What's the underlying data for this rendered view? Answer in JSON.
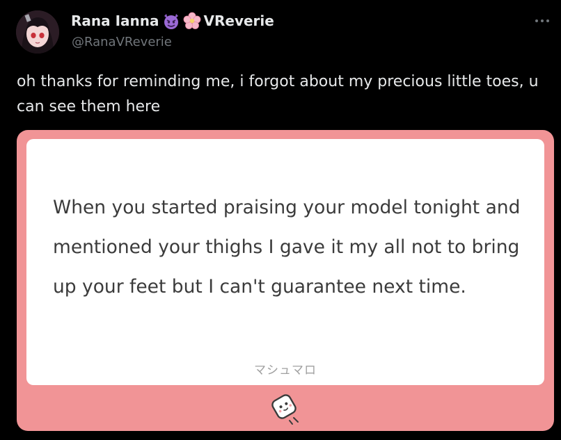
{
  "author": {
    "display_name": "Rana Ianna",
    "name_suffix": "VReverie",
    "handle": "@RanaVReverie",
    "emojis": [
      "smiling-imp-emoji",
      "cherry-blossom-emoji"
    ]
  },
  "tweet": {
    "text": "oh thanks for reminding me, i forgot about my precious little toes, u can see them here"
  },
  "card": {
    "question": "When you started praising your model tonight and mentioned your thighs I gave it my all not to bring up your feet but I can't guarantee next time.",
    "brand": "マシュマロ",
    "icon": "marshmallow-icon"
  },
  "colors": {
    "background": "#000000",
    "card_pink": "#f19496",
    "handle_gray": "#71767b"
  }
}
